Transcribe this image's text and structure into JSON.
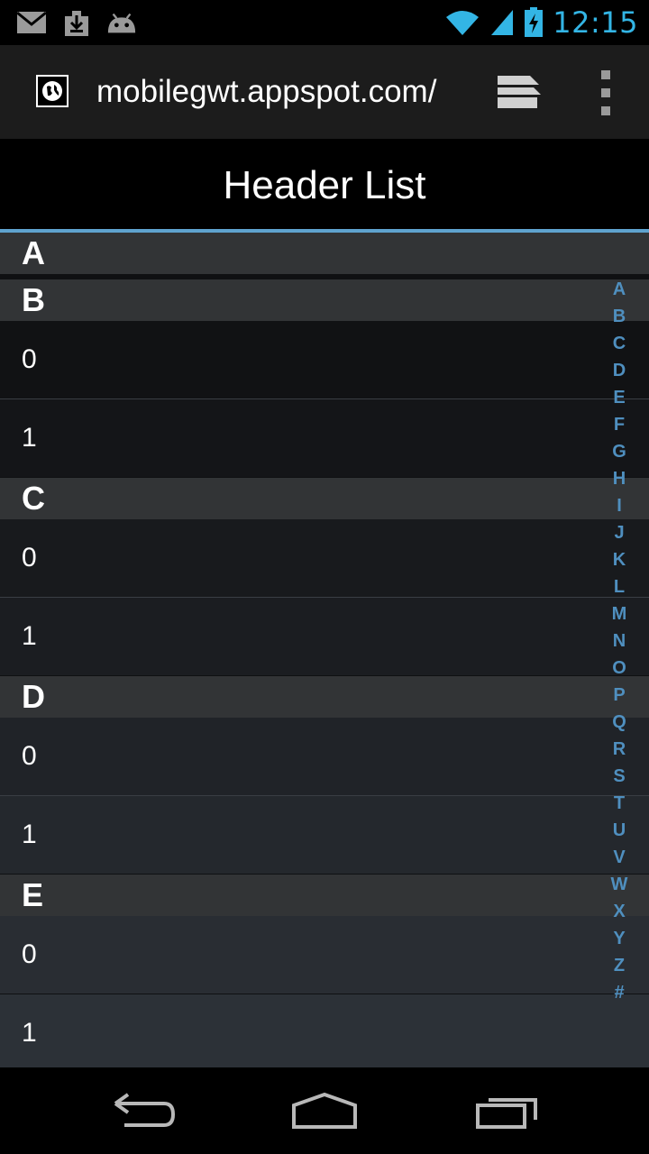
{
  "status_bar": {
    "time": "12:15",
    "left_icons": [
      "mail-icon",
      "download-icon",
      "android-icon"
    ],
    "right_icons": [
      "wifi-icon",
      "signal-icon",
      "battery-charging-icon"
    ],
    "accent": "#33b5e5"
  },
  "browser": {
    "url": "mobilegwt.appspot.com/",
    "favicon": "globe-icon",
    "tabs_icon": "tabs-icon",
    "menu_icon": "overflow-menu-icon"
  },
  "page": {
    "title": "Header List",
    "accent_line_color": "#5fa3cf"
  },
  "list": {
    "sections": [
      {
        "header": "A",
        "items": []
      },
      {
        "header": "B",
        "items": [
          "0",
          "1"
        ]
      },
      {
        "header": "C",
        "items": [
          "0",
          "1"
        ]
      },
      {
        "header": "D",
        "items": [
          "0",
          "1"
        ]
      },
      {
        "header": "E",
        "items": [
          "0",
          "1"
        ]
      }
    ]
  },
  "index_letters": [
    "A",
    "B",
    "C",
    "D",
    "E",
    "F",
    "G",
    "H",
    "I",
    "J",
    "K",
    "L",
    "M",
    "N",
    "O",
    "P",
    "Q",
    "R",
    "S",
    "T",
    "U",
    "V",
    "W",
    "X",
    "Y",
    "Z",
    "#"
  ],
  "nav_bar": {
    "back_icon": "back-icon",
    "home_icon": "home-icon",
    "recents_icon": "recent-apps-icon"
  }
}
